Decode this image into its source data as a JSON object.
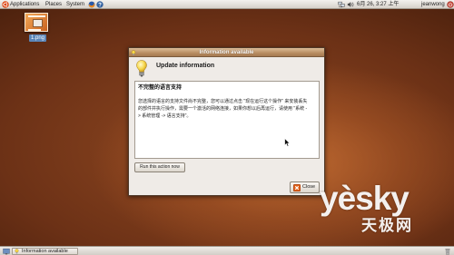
{
  "top_panel": {
    "logo_icon": "ubuntu-logo-icon",
    "menus": [
      "Applications",
      "Places",
      "System"
    ],
    "launchers": [
      "firefox-icon",
      "help-icon"
    ],
    "tray_icons": [
      "network-icon",
      "volume-icon"
    ],
    "clock": "6月 26, 3:27 上午",
    "user": "jeanwong",
    "power_icon": "power-icon"
  },
  "desktop": {
    "icons": [
      {
        "label": "1.png",
        "icon": "image-file-icon",
        "selected": true
      }
    ]
  },
  "dialog": {
    "title": "Information available",
    "title_icon": "update-notifier-icon",
    "heading_icon": "lightbulb-icon",
    "heading": "Update information",
    "message_title": "不完整的语言支持",
    "message_lines": [
      "您选择的语言的支持文件尚不完整，您可以通过点击 \"现在运行这个操作\" 来安装丢失",
      "的部件并执行操作，需要一个激活的网络连接，如果你想以后再运行，请使用 \"系统 -",
      "> 系统管理 -> 语言支持\"。"
    ],
    "run_button": "Run this action now",
    "close_button": "Close",
    "close_icon": "close-icon"
  },
  "cursor_icon": "mouse-pointer-icon",
  "bottom_panel": {
    "show_desktop_icon": "show-desktop-icon",
    "tasks": [
      {
        "label": "Information available",
        "icon": "update-notifier-icon"
      }
    ],
    "trash_icon": "trash-icon"
  },
  "watermark": {
    "logo": "yèsky",
    "name": "天极网"
  },
  "colors": {
    "desktop": "#8a4420",
    "panel": "#dcd8d2",
    "titlebar": "#b58a5f",
    "dialog_bg": "#efebe7",
    "selection": "#5b86b8",
    "close_icon": "#e2641e"
  }
}
